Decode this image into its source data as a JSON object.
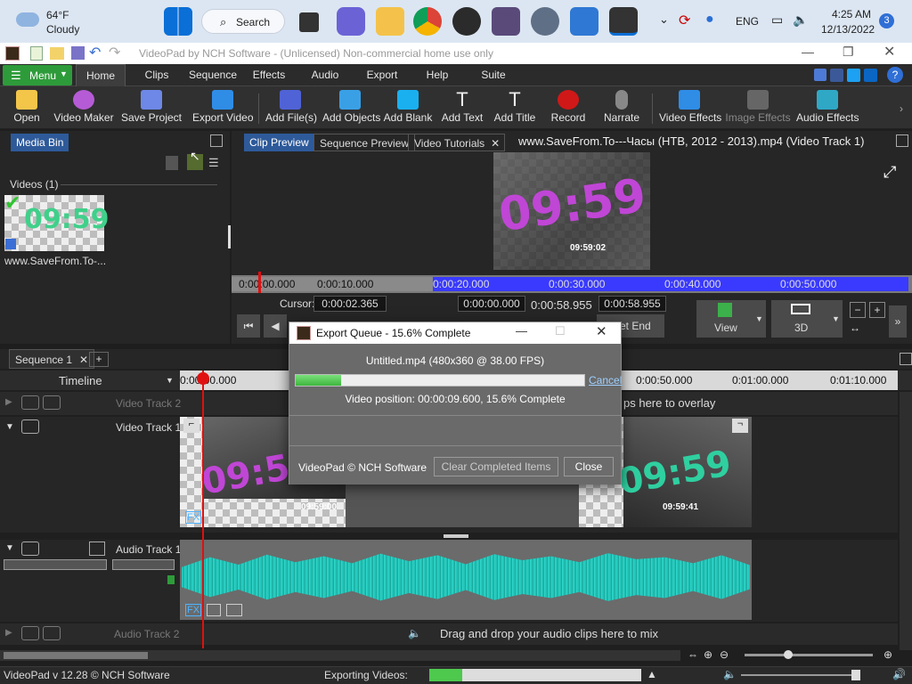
{
  "taskbar": {
    "weather_temp": "64°F",
    "weather_desc": "Cloudy",
    "search_label": "Search",
    "lang": "ENG",
    "time": "4:25 AM",
    "date": "12/13/2022",
    "notif_count": "3"
  },
  "window": {
    "title": "VideoPad by NCH Software - (Unlicensed) Non-commercial home use only"
  },
  "menu": {
    "menu_label": "Menu",
    "tabs": [
      "Home",
      "Clips",
      "Sequence",
      "Effects",
      "Audio",
      "Export",
      "Help",
      "Suite"
    ]
  },
  "ribbon": {
    "buttons": [
      "Open",
      "Video Maker",
      "Save Project",
      "Export Video",
      "Add File(s)",
      "Add Objects",
      "Add Blank",
      "Add Text",
      "Add Title",
      "Record",
      "Narrate",
      "Video Effects",
      "Image Effects",
      "Audio Effects"
    ]
  },
  "mediabin": {
    "tab": "Media Bin",
    "section": "Videos (1)",
    "item_name": "www.SaveFrom.To-..."
  },
  "preview": {
    "tabs": [
      "Clip Preview",
      "Sequence Preview",
      "Video Tutorials"
    ],
    "file_title": "www.SaveFrom.To---Часы (НТВ, 2012 - 2013).mp4 (Video Track 1)",
    "ruler": [
      "0:00:00.000",
      "0:00:10.000",
      "0:00:20.000",
      "0:00:30.000",
      "0:00:40.000",
      "0:00:50.000"
    ],
    "cursor_label": "Cursor:",
    "cursor_value": "0:00:02.365",
    "start_value": "0:00:00.000",
    "duration_value": "0:00:58.955",
    "end_value": "0:00:58.955",
    "set_end": "et End",
    "view_label": "View",
    "threed_label": "3D",
    "thumb_time": "09:59:02"
  },
  "sequence": {
    "tab": "Sequence 1",
    "timeline_label": "Timeline",
    "ruler": [
      "0:00:00.000",
      "0:00:50.000",
      "0:01:00.000",
      "0:01:10.000"
    ],
    "video_track2": "Video Track 2",
    "video_track1": "Video Track 1",
    "audio_track1": "Audio Track 1",
    "audio_track2": "Audio Track 2",
    "overlay_hint": "ps here to overlay",
    "audio_hint": "Drag and drop your audio clips here to mix",
    "clip_time_a": "09:59:00",
    "clip_time_b": "09:59:41",
    "fx": "FX"
  },
  "dialog": {
    "title": "Export Queue - 15.6% Complete",
    "file_info": "Untitled.mp4 (480x360 @ 38.00 FPS)",
    "cancel": "Cancel",
    "position": "Video position:  00:00:09.600, 15.6% Complete",
    "progress": 0.156,
    "brand": "VideoPad © NCH Software",
    "clear_btn": "Clear Completed Items",
    "close_btn": "Close"
  },
  "status": {
    "version": "VideoPad v 12.28 © NCH Software",
    "exporting_label": "Exporting Videos:",
    "export_progress": 0.156
  },
  "colors": {
    "accent_green": "#2e9b3a",
    "progress_green": "#4ec94e",
    "playhead_red": "#e01010",
    "selection_blue": "#3a3aff"
  }
}
